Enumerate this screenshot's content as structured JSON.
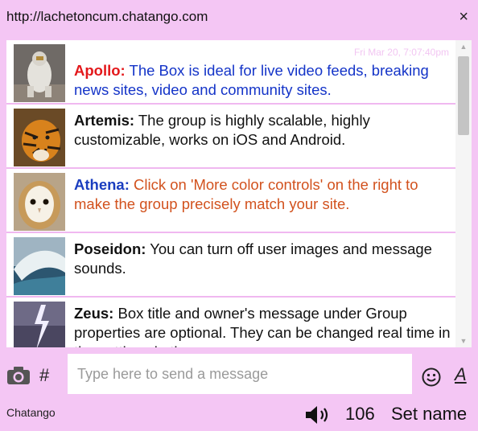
{
  "header": {
    "url": "http://lacheto­ncum.chatango.com",
    "close_label": "×"
  },
  "messages": [
    {
      "name": "Apollo:",
      "text": "The Box is ideal for live video feeds, breaking news sites, video and community sites.",
      "timestamp": "Fri Mar 20, 7:07:40pm",
      "name_color": "#e3181b",
      "text_color": "#1434c8"
    },
    {
      "name": "Artemis:",
      "text": "The group is highly scalable, highly customizable, works on iOS and Android.",
      "name_color": "#111111",
      "text_color": "#111111"
    },
    {
      "name": "Athena:",
      "text": "Click on 'More color controls' on the right to make the group precisely match your site.",
      "name_color": "#1a3dbf",
      "text_color": "#d2521e"
    },
    {
      "name": "Poseidon:",
      "text": "You can turn off user images and message sounds.",
      "name_color": "#111111",
      "text_color": "#111111"
    },
    {
      "name": "Zeus:",
      "text": "Box title and owner's message under Group properties are optional. They can be changed real time in the settings in the group.",
      "name_color": "#111111",
      "text_color": "#111111"
    }
  ],
  "input": {
    "placeholder": "Type here to send a message"
  },
  "footer": {
    "brand": "Chatango",
    "user_count": "106",
    "set_name": "Set name",
    "hash": "#",
    "font_label": "A"
  },
  "icons": [
    "camera-icon",
    "smiley-icon",
    "speaker-icon",
    "close-icon"
  ]
}
